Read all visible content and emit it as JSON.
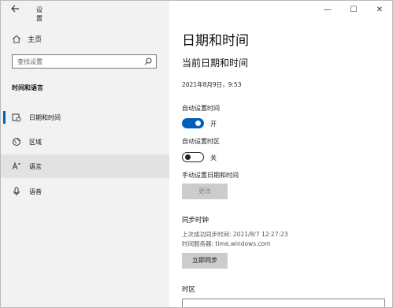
{
  "titlebar": {
    "back_icon": "back-arrow-icon",
    "app_title": "设置"
  },
  "window_controls": {
    "minimize": "—",
    "maximize": "☐",
    "close": "✕"
  },
  "sidebar": {
    "home_label": "主页",
    "search": {
      "placeholder": "查找设置",
      "value": ""
    },
    "section_title": "时间和语言",
    "items": [
      {
        "label": "日期和时间",
        "icon": "calendar-clock-icon",
        "active": true
      },
      {
        "label": "区域",
        "icon": "globe-icon",
        "active": false
      },
      {
        "label": "语言",
        "icon": "language-icon",
        "active": false
      },
      {
        "label": "语音",
        "icon": "microphone-icon",
        "active": false
      }
    ]
  },
  "main": {
    "page_title": "日期和时间",
    "current_heading": "当前日期和时间",
    "current_datetime": "2021年8月9日，9:53",
    "auto_time": {
      "label": "自动设置时间",
      "state_text": "开",
      "on": true
    },
    "auto_timezone": {
      "label": "自动设置时区",
      "state_text": "关",
      "on": false
    },
    "manual": {
      "label": "手动设置日期和时间",
      "button": "更改"
    },
    "sync": {
      "heading": "同步时钟",
      "last_sync": "上次成功同步时间: 2021/8/7 12:27:23",
      "server": "时间服务器: time.windows.com",
      "button": "立即同步"
    },
    "timezone": {
      "heading": "时区"
    }
  },
  "colors": {
    "accent": "#005fb8",
    "sidebar_bg": "#f2f2f2",
    "hover_bg": "#e2e2e2",
    "button_bg": "#cccccc"
  }
}
